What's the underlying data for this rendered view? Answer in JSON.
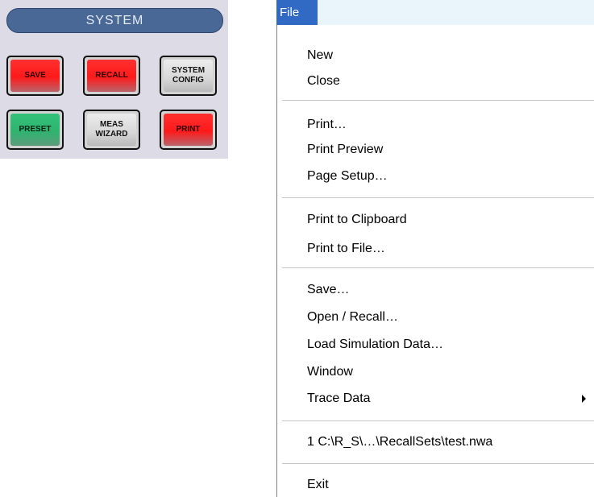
{
  "system_panel": {
    "title": "SYSTEM",
    "keys": [
      {
        "label": "SAVE",
        "color": "#ff2020"
      },
      {
        "label": "RECALL",
        "color": "#ff2020"
      },
      {
        "label": "SYSTEM\nCONFIG",
        "color": "#d7d7d7"
      },
      {
        "label": "PRESET",
        "color": "#2fb46f"
      },
      {
        "label": "MEAS\nWIZARD",
        "color": "#d7d7d7"
      },
      {
        "label": "PRINT",
        "color": "#ff2020"
      }
    ]
  },
  "menu": {
    "bar_title": "File",
    "highlight_color": "#316ac5",
    "items": {
      "new": "New",
      "close": "Close",
      "print": "Print…",
      "print_preview": "Print Preview",
      "page_setup": "Page Setup…",
      "print_to_clipboard": "Print to Clipboard",
      "print_to_file": "Print to File…",
      "save": "Save…",
      "open_recall": "Open / Recall…",
      "load_simulation_data": "Load Simulation Data…",
      "window": "Window",
      "trace_data": "Trace Data",
      "recent_file": "1 C:\\R_S\\…\\RecallSets\\test.nwa",
      "exit": "Exit"
    }
  }
}
